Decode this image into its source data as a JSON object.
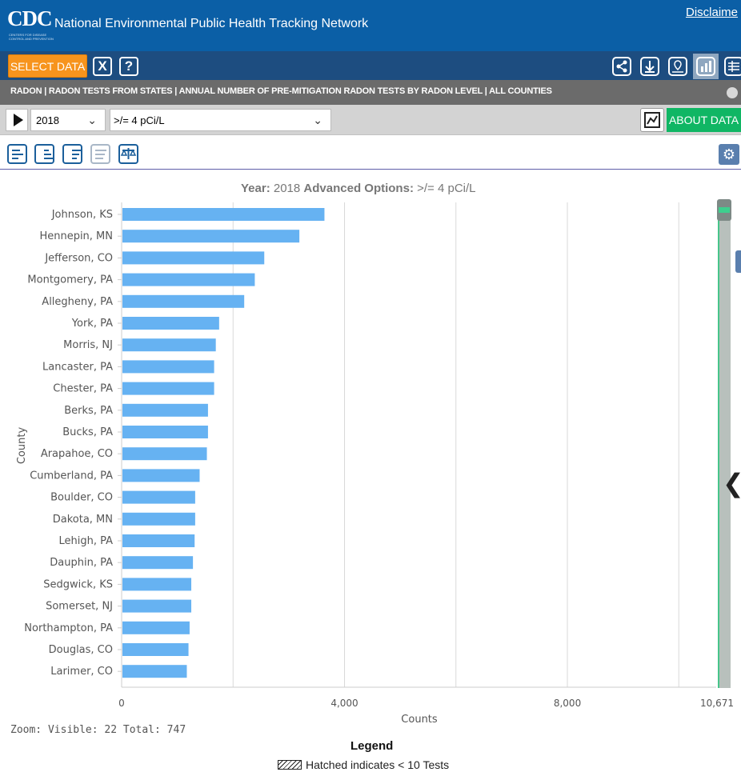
{
  "header": {
    "logo_text": "CDC",
    "logo_subtext": "CENTERS FOR DISEASE CONTROL AND PREVENTION",
    "title": "National Environmental Public Health Tracking Network",
    "disclaimer": "Disclaime"
  },
  "toolbar": {
    "select_data_label": "SELECT DATA",
    "clear_label": "X",
    "help_label": "?",
    "right_tools": [
      "share-icon",
      "download-icon",
      "map-view-icon",
      "chart-view-icon",
      "table-view-icon"
    ]
  },
  "breadcrumb": {
    "text": "RADON | RADON TESTS FROM STATES | ANNUAL NUMBER OF PRE-MITIGATION RADON TESTS BY RADON LEVEL | ALL COUNTIES"
  },
  "controls": {
    "year": "2018",
    "option": ">/= 4 pCi/L",
    "about_label": "ABOUT DATA"
  },
  "chart_tools": [
    "sort-default-icon",
    "sort-ascending-icon",
    "sort-descending-icon",
    "filter-icon",
    "compare-icon"
  ],
  "chart_header": {
    "year_label": "Year:",
    "year_value": "2018",
    "options_label": "Advanced Options:",
    "options_value": ">/= 4 pCi/L"
  },
  "chart_data": {
    "type": "bar",
    "orientation": "horizontal",
    "categories": [
      "Johnson, KS",
      "Hennepin, MN",
      "Jefferson, CO",
      "Montgomery, PA",
      "Allegheny, PA",
      "York, PA",
      "Morris, NJ",
      "Lancaster, PA",
      "Chester, PA",
      "Berks, PA",
      "Bucks, PA",
      "Arapahoe, CO",
      "Cumberland, PA",
      "Boulder, CO",
      "Dakota, MN",
      "Lehigh, PA",
      "Dauphin, PA",
      "Sedgwick, KS",
      "Somerset, NJ",
      "Northampton, PA",
      "Douglas, CO",
      "Larimer, CO"
    ],
    "values": [
      3640,
      3190,
      2560,
      2390,
      2200,
      1750,
      1690,
      1660,
      1660,
      1550,
      1550,
      1530,
      1400,
      1320,
      1320,
      1310,
      1280,
      1250,
      1250,
      1220,
      1200,
      1170
    ],
    "color": "#66b2f2",
    "xlabel": "Counts",
    "ylabel": "County",
    "xlim": [
      0,
      10671
    ],
    "tick_labels": [
      "0",
      "4,000",
      "8,000",
      "10,671"
    ],
    "tick_values": [
      0,
      4000,
      8000,
      10671
    ],
    "grid_values": [
      2000,
      4000,
      6000,
      8000,
      10000
    ],
    "grid": true
  },
  "zoom_text": "Zoom: Visible: 22 Total: 747",
  "legend": {
    "title": "Legend",
    "item": "Hatched indicates < 10 Tests"
  }
}
